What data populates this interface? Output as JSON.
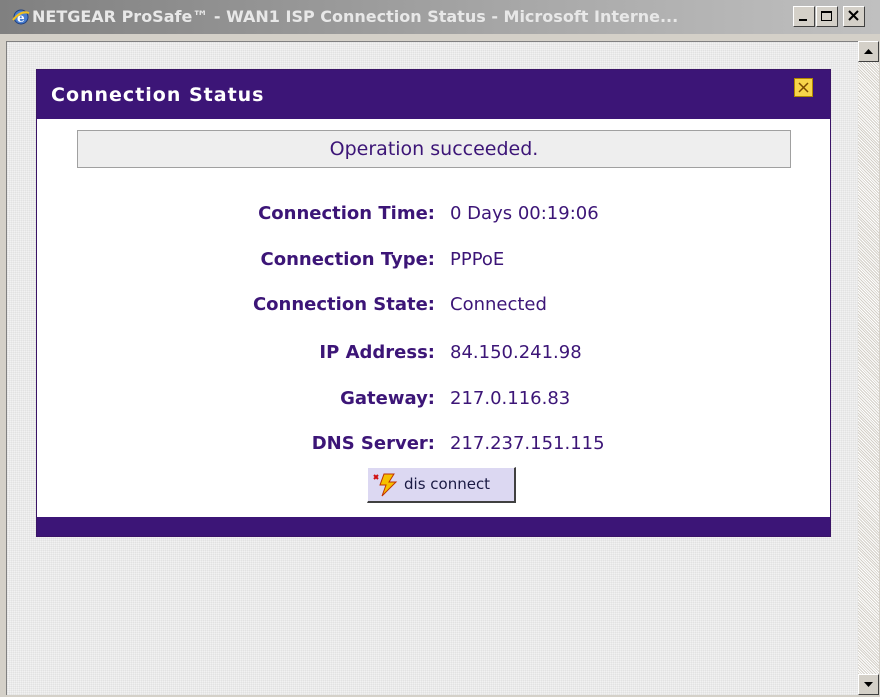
{
  "window": {
    "title": "NETGEAR ProSafe™ - WAN1 ISP Connection Status - Microsoft Interne...",
    "icon": "ie-browser-icon"
  },
  "panel": {
    "title": "Connection Status",
    "close_icon": "close-icon",
    "message": "Operation succeeded.",
    "rows": [
      {
        "label": "Connection Time:",
        "value": "0 Days 00:19:06"
      },
      {
        "label": "Connection Type:",
        "value": "PPPoE"
      },
      {
        "label": "Connection State:",
        "value": "Connected"
      },
      {
        "label": "IP Address:",
        "value": "84.150.241.98"
      },
      {
        "label": "Gateway:",
        "value": "217.0.116.83"
      },
      {
        "label": "DNS Server:",
        "value": "217.237.151.115"
      }
    ],
    "disconnect_label": "dis connect"
  },
  "colors": {
    "accent": "#3c1577",
    "close_button": "#f7d54a"
  }
}
